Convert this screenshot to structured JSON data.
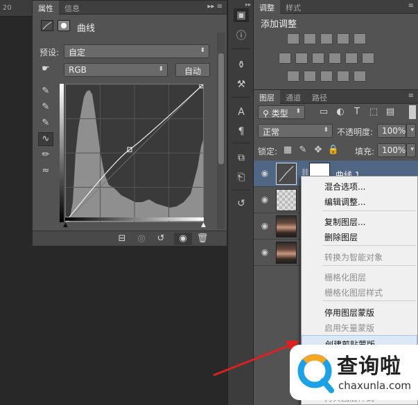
{
  "ruler": {
    "label": "20"
  },
  "properties": {
    "tabs": [
      {
        "label": "属性"
      },
      {
        "label": "信息"
      }
    ],
    "title": "曲线",
    "preset_label": "预设:",
    "preset_value": "自定",
    "channel_value": "RGB",
    "auto_button": "自动"
  },
  "adjustments": {
    "tabs": [
      {
        "label": "调整"
      },
      {
        "label": "样式"
      }
    ],
    "heading": "添加调整"
  },
  "layers": {
    "tabs": [
      {
        "label": "图层"
      },
      {
        "label": "通道"
      },
      {
        "label": "路径"
      }
    ],
    "filter_value": "类型",
    "blend_mode": "正常",
    "opacity_label": "不透明度:",
    "opacity_value": "100%",
    "lock_label": "锁定:",
    "fill_label": "填充:",
    "fill_value": "100%",
    "rows": [
      {
        "name": "曲线 1"
      }
    ]
  },
  "context_menu": {
    "items": [
      {
        "label": "混合选项..."
      },
      {
        "label": "编辑调整..."
      },
      {
        "label": "复制图层..."
      },
      {
        "label": "删除图层"
      },
      {
        "label": "转换为智能对象"
      },
      {
        "label": "栅格化图层"
      },
      {
        "label": "栅格化图层样式"
      },
      {
        "label": "停用图层蒙版"
      },
      {
        "label": "启用矢量蒙版"
      },
      {
        "label": "创建剪贴蒙版"
      },
      {
        "label": "拷贝图层样式"
      }
    ]
  },
  "watermark": {
    "brand": "查询啦",
    "domain": "chaxunla.com"
  }
}
